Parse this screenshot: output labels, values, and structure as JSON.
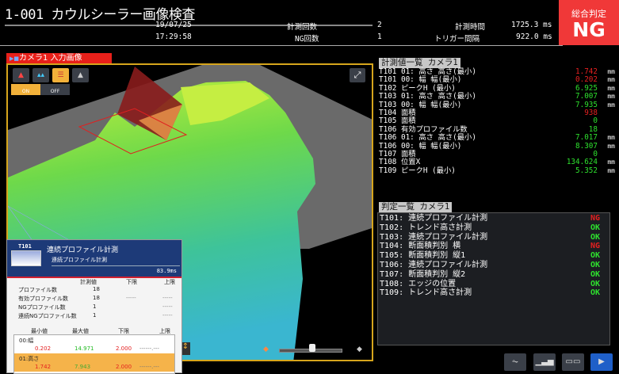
{
  "header": {
    "title": "1-001 カウルシーラー画像検査",
    "date": "19/07/25",
    "time": "17:29:58",
    "count_label": "計測回数",
    "count": "2",
    "ng_count_label": "NG回数",
    "ng_count": "1",
    "meas_time_label": "計測時間",
    "meas_time": "1725.3 ms",
    "trigger_label": "トリガー間隔",
    "trigger": "922.0 ms",
    "overall_label": "総合判定",
    "overall": "NG"
  },
  "image_panel": {
    "label": "カメラ1 入力画像",
    "toggle_on": "ON",
    "toggle_off": "OFF"
  },
  "measurements": {
    "title": "計測値一覧 カメラ1",
    "rows": [
      {
        "label": "T101 01: 高さ 高さ(最小)",
        "value": "1.742",
        "unit": "mm",
        "status": "ng"
      },
      {
        "label": "T101 00: 幅 幅(最小)",
        "value": "0.202",
        "unit": "mm",
        "status": "ng"
      },
      {
        "label": "T102 ピークH (最小)",
        "value": "6.925",
        "unit": "mm",
        "status": "ok"
      },
      {
        "label": "T103 01: 高さ 高さ(最小)",
        "value": "7.007",
        "unit": "mm",
        "status": "ok"
      },
      {
        "label": "T103 00: 幅 幅(最小)",
        "value": "7.935",
        "unit": "mm",
        "status": "ok"
      },
      {
        "label": "T104 面積",
        "value": "938",
        "unit": "",
        "status": "ng"
      },
      {
        "label": "T105 面積",
        "value": "0",
        "unit": "",
        "status": "ok"
      },
      {
        "label": "T106 有効プロファイル数",
        "value": "18",
        "unit": "",
        "status": "ok"
      },
      {
        "label": "T106 01: 高さ 高さ(最小)",
        "value": "7.017",
        "unit": "mm",
        "status": "ok"
      },
      {
        "label": "T106 00: 幅 幅(最小)",
        "value": "8.307",
        "unit": "mm",
        "status": "ok"
      },
      {
        "label": "T107 面積",
        "value": "0",
        "unit": "",
        "status": "ok"
      },
      {
        "label": "T108 位置X",
        "value": "134.624",
        "unit": "mm",
        "status": "ok"
      },
      {
        "label": "T109 ピークH (最小)",
        "value": "5.352",
        "unit": "mm",
        "status": "ok"
      }
    ]
  },
  "judgements": {
    "title": "判定一覧 カメラ1",
    "rows": [
      {
        "label": "T101: 連続プロファイル計測",
        "result": "NG"
      },
      {
        "label": "T102: トレンド高さ計測",
        "result": "OK"
      },
      {
        "label": "T103: 連続プロファイル計測",
        "result": "OK"
      },
      {
        "label": "T104: 断面積判別 横",
        "result": "NG"
      },
      {
        "label": "T105: 断面積判別 縦1",
        "result": "OK"
      },
      {
        "label": "T106: 連続プロファイル計測",
        "result": "OK"
      },
      {
        "label": "T107: 断面積判別 縦2",
        "result": "OK"
      },
      {
        "label": "T108: エッジの位置",
        "result": "OK"
      },
      {
        "label": "T109: トレンド高さ計測",
        "result": "OK"
      }
    ]
  },
  "detail": {
    "tool_id": "T101",
    "title": "連続プロファイル計測",
    "subtitle": "連続プロファイル計測",
    "time": "83.9ms",
    "cols": [
      "計測値",
      "下限",
      "上限"
    ],
    "rows": [
      {
        "label": "プロファイル数",
        "value": "18",
        "lo": "",
        "hi": ""
      },
      {
        "label": "有効プロファイル数",
        "value": "18",
        "lo": "-----",
        "hi": "-----"
      },
      {
        "label": "NGプロファイル数",
        "value": "1",
        "lo": "",
        "hi": "-----"
      },
      {
        "label": "連続NGプロファイル数",
        "value": "1",
        "lo": "",
        "hi": "-----"
      }
    ],
    "cols2": [
      "最小値",
      "最大値",
      "下限",
      "上限"
    ],
    "items": [
      {
        "name": "00:幅",
        "min": "0.202",
        "max": "14.971",
        "lo": "2.000",
        "hi": "------.---"
      },
      {
        "name": "01:高さ",
        "min": "1.742",
        "max": "7.943",
        "lo": "2.000",
        "hi": "------.---"
      }
    ]
  },
  "colors": {
    "ng": "#e52020",
    "ok": "#2ee02e",
    "accent": "#f2b13a",
    "frame": "#d6a51c"
  }
}
